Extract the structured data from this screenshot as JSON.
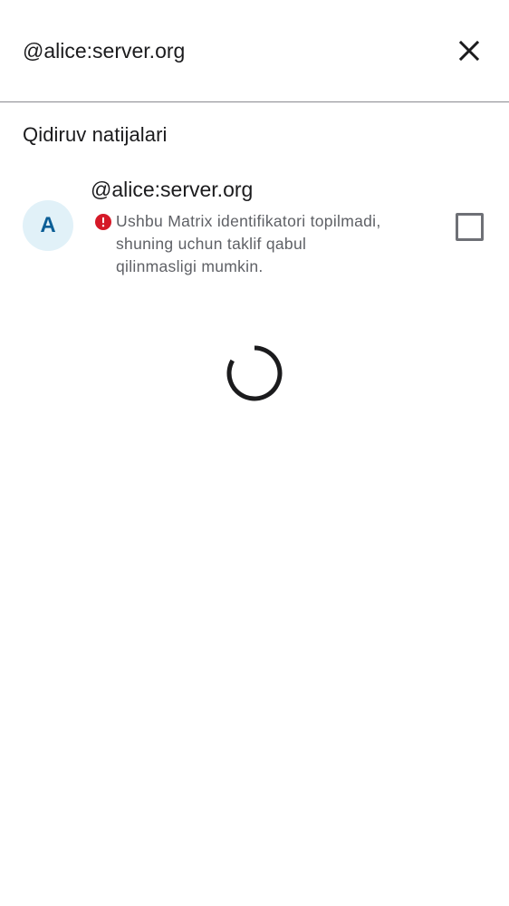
{
  "search": {
    "value": "@alice:server.org",
    "clear_icon": "close-icon"
  },
  "results": {
    "section_title": "Qidiruv natijalari",
    "items": [
      {
        "avatar_letter": "A",
        "name": "@alice:server.org",
        "error_message": "Ushbu Matrix identifikatori topilmadi, shuning uchun taklif qabul qilinmasligi mumkin.",
        "checked": false
      }
    ]
  },
  "loading": true,
  "colors": {
    "avatar_bg": "#e1f1f8",
    "avatar_text": "#0b5e96",
    "error": "#d51928",
    "divider": "#8a8a90"
  }
}
